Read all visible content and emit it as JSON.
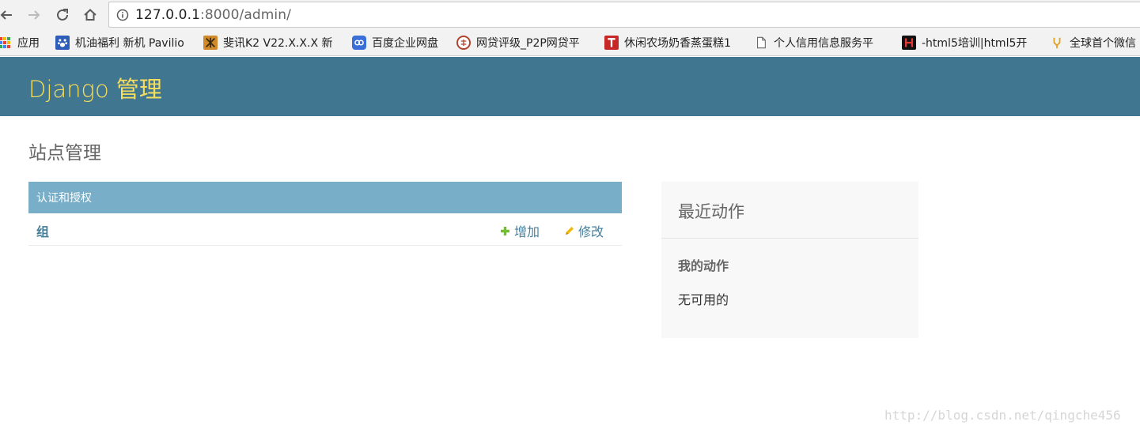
{
  "browser": {
    "url_host": "127.0.0.1",
    "url_rest": ":8000/admin/",
    "nav_icons": [
      "back-arrow-icon",
      "forward-arrow-icon",
      "reload-icon",
      "home-icon"
    ]
  },
  "bookmarks": [
    {
      "label": "应用",
      "icon": "apps-grid-icon"
    },
    {
      "label": "机油福利 新机 Pavilio",
      "icon": "baidu-paw-icon",
      "color": "#2d5db8"
    },
    {
      "label": "斐讯K2 V22.X.X.X 新",
      "icon": "k2-icon",
      "color": "#d08a2a"
    },
    {
      "label": "百度企业网盘",
      "icon": "baidu-netdisk-icon",
      "color": "#3b6fd8"
    },
    {
      "label": "网贷评级_P2P网贷平",
      "icon": "circle-logo-icon",
      "color": "#b0452f"
    },
    {
      "label": "休闲农场奶香蒸蛋糕1",
      "icon": "t-logo-icon",
      "color": "#c62828"
    },
    {
      "label": "个人信用信息服务平",
      "icon": "page-icon"
    },
    {
      "label": "-html5培训|html5开",
      "icon": "h-logo-icon",
      "color": "#111111"
    },
    {
      "label": "全球首个微信",
      "icon": "fork-icon",
      "color": "#e0a020"
    }
  ],
  "header": {
    "branding": "Django 管理"
  },
  "content": {
    "title": "站点管理"
  },
  "app_module": {
    "caption": "认证和授权",
    "models": [
      {
        "name": "组",
        "add_label": "增加",
        "change_label": "修改"
      }
    ]
  },
  "recent_actions": {
    "title": "最近动作",
    "my_actions": "我的动作",
    "none_available": "无可用的"
  },
  "watermark": "http://blog.csdn.net/qingche456",
  "colors": {
    "header_bg": "#417690",
    "branding": "#f5dd5d",
    "module_caption_bg": "#79aec8",
    "link": "#447e9b",
    "add_icon": "#70bf2b",
    "change_icon": "#efb80b"
  }
}
